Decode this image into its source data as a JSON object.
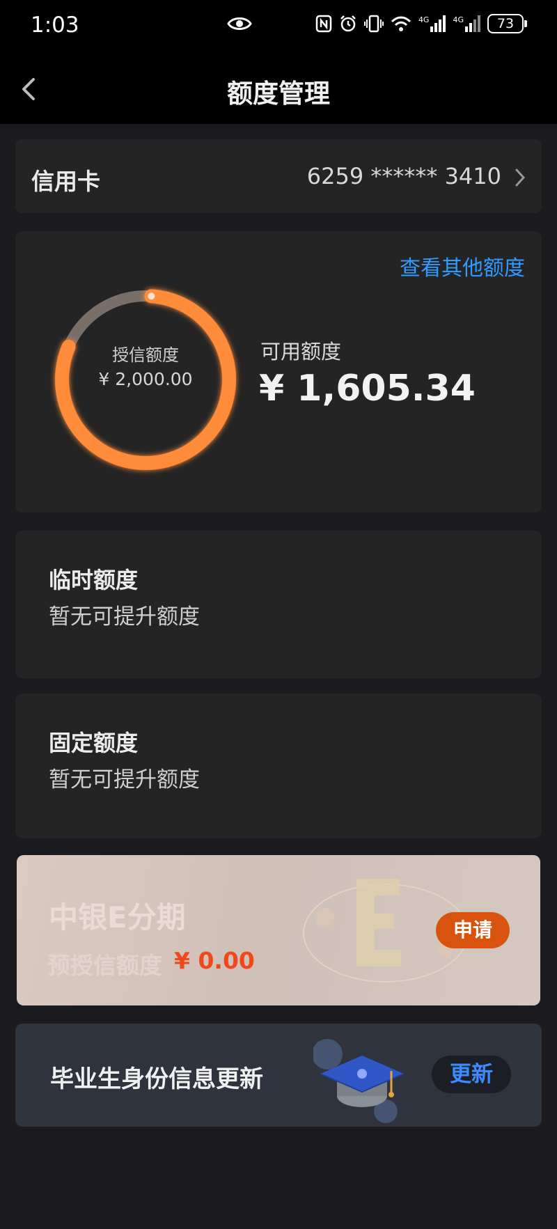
{
  "status_bar": {
    "time": "1:03",
    "network_1": "4G",
    "network_2": "4G",
    "battery": "73",
    "icons": [
      "eye-icon",
      "nfc-icon",
      "alarm-icon",
      "vibrate-icon",
      "wifi-icon",
      "signal-icon",
      "signal-icon",
      "battery-icon"
    ]
  },
  "header": {
    "title": "额度管理",
    "back_icon": "chevron-left-icon"
  },
  "card": {
    "label": "信用卡",
    "number": "6259 ****** 3410",
    "chevron_icon": "chevron-right-icon"
  },
  "limit": {
    "other_link": "查看其他额度",
    "credit_label": "授信额度",
    "credit_value": "¥ 2,000.00",
    "available_label": "可用额度",
    "available_value": "¥ 1,605.34",
    "available_fraction": 0.8027,
    "colors": {
      "ring_available": "#ff8c3a",
      "ring_used": "#7a6f68"
    }
  },
  "temporary": {
    "title": "临时额度",
    "subtitle": "暂无可提升额度"
  },
  "fixed": {
    "title": "固定额度",
    "subtitle": "暂无可提升额度"
  },
  "installment": {
    "title": "中银E分期",
    "pre_credit_label": "预授信额度",
    "pre_credit_value": "¥ 0.00",
    "apply_label": "申请",
    "colors": {
      "apply_bg": "#d8540e",
      "amount": "#f04818"
    }
  },
  "graduate": {
    "label": "毕业生身份信息更新",
    "update_label": "更新",
    "icon": "graduation-cap-icon",
    "colors": {
      "update_text": "#3d8cff"
    }
  }
}
